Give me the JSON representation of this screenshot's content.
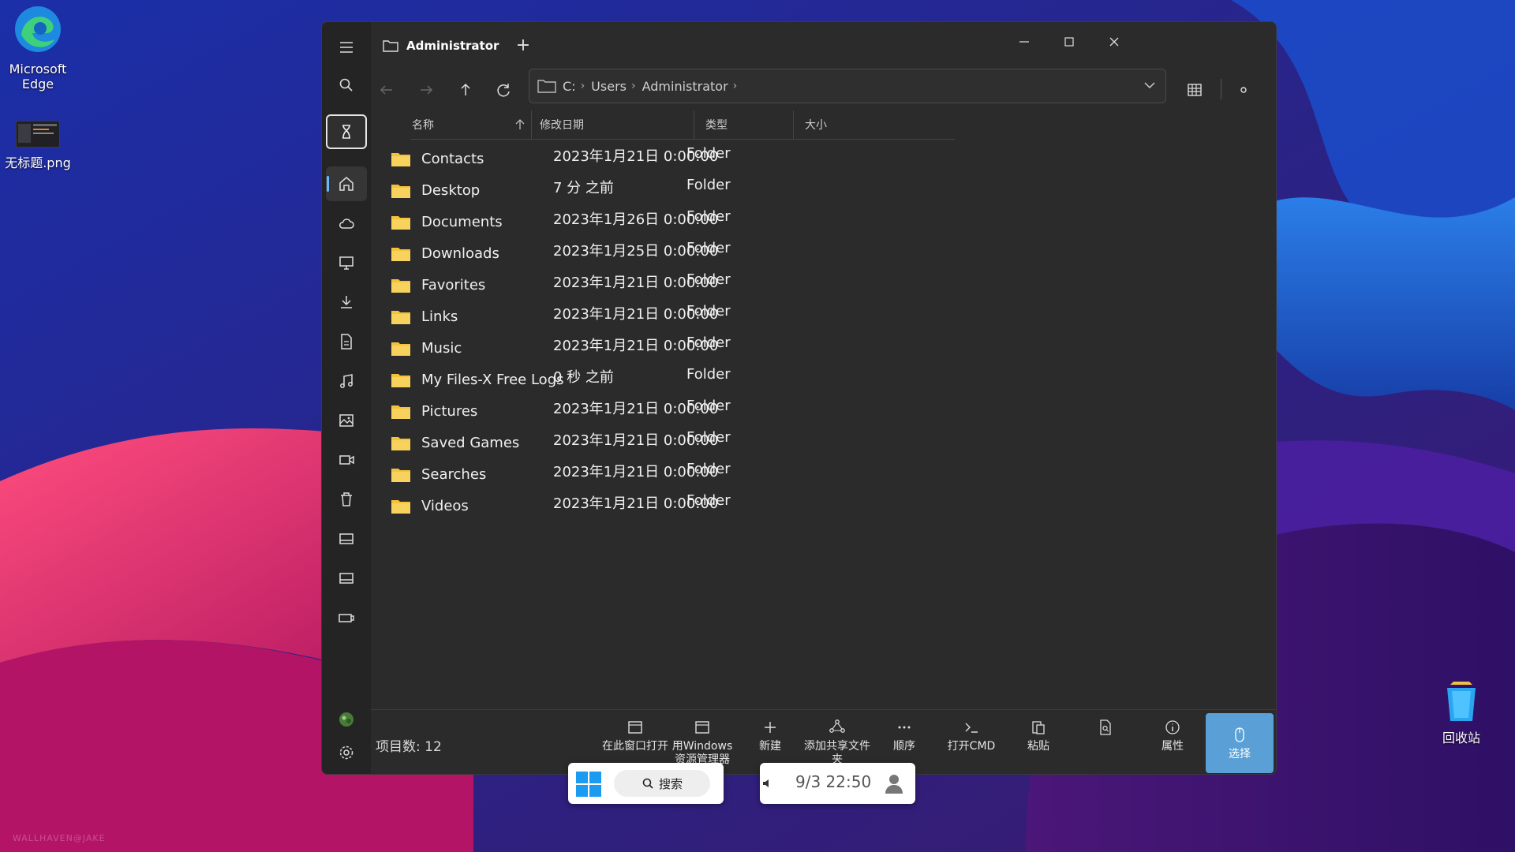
{
  "desktop": {
    "icons": [
      {
        "label": "Microsoft Edge"
      },
      {
        "label": "无标题.png"
      },
      {
        "label": "回收站"
      }
    ],
    "watermark": "WALLHAVEN@JAKE"
  },
  "window": {
    "tab_title": "Administrator",
    "address": {
      "crumbs": [
        "C:",
        "Users",
        "Administrator"
      ]
    },
    "columns": {
      "name": "名称",
      "modified": "修改日期",
      "type": "类型",
      "size": "大小"
    },
    "rows": [
      {
        "name": "Contacts",
        "date": "2023年1月21日 0:00:00",
        "type": "Folder"
      },
      {
        "name": "Desktop",
        "date": "7 分 之前",
        "type": "Folder"
      },
      {
        "name": "Documents",
        "date": "2023年1月26日 0:00:00",
        "type": "Folder"
      },
      {
        "name": "Downloads",
        "date": "2023年1月25日 0:00:00",
        "type": "Folder"
      },
      {
        "name": "Favorites",
        "date": "2023年1月21日 0:00:00",
        "type": "Folder"
      },
      {
        "name": "Links",
        "date": "2023年1月21日 0:00:00",
        "type": "Folder"
      },
      {
        "name": "Music",
        "date": "2023年1月21日 0:00:00",
        "type": "Folder"
      },
      {
        "name": "My Files-X Free Logs",
        "date": "0 秒 之前",
        "type": "Folder"
      },
      {
        "name": "Pictures",
        "date": "2023年1月21日 0:00:00",
        "type": "Folder"
      },
      {
        "name": "Saved Games",
        "date": "2023年1月21日 0:00:00",
        "type": "Folder"
      },
      {
        "name": "Searches",
        "date": "2023年1月21日 0:00:00",
        "type": "Folder"
      },
      {
        "name": "Videos",
        "date": "2023年1月21日 0:00:00",
        "type": "Folder"
      }
    ],
    "status": {
      "item_count": "项目数: 12"
    },
    "commands": [
      {
        "label": "在此窗口打开",
        "icon": "window-icon"
      },
      {
        "label": "用Windows资源管理器",
        "icon": "explorer-icon"
      },
      {
        "label": "新建",
        "icon": "plus-icon"
      },
      {
        "label": "添加共享文件夹",
        "icon": "share-icon"
      },
      {
        "label": "顺序",
        "icon": "more-icon"
      },
      {
        "label": "打开CMD",
        "icon": "terminal-icon"
      },
      {
        "label": "粘贴",
        "icon": "paste-icon"
      },
      {
        "label": "",
        "icon": "file-search-icon"
      },
      {
        "label": "属性",
        "icon": "info-icon"
      },
      {
        "label": "选择",
        "icon": "mouse-icon"
      }
    ]
  },
  "taskbar": {
    "search_label": "搜索",
    "clock": "9/3  22:50"
  },
  "colors": {
    "accent": "#5aa0d6",
    "folder": "#f4c23a",
    "window_bg": "#2b2b2b"
  }
}
